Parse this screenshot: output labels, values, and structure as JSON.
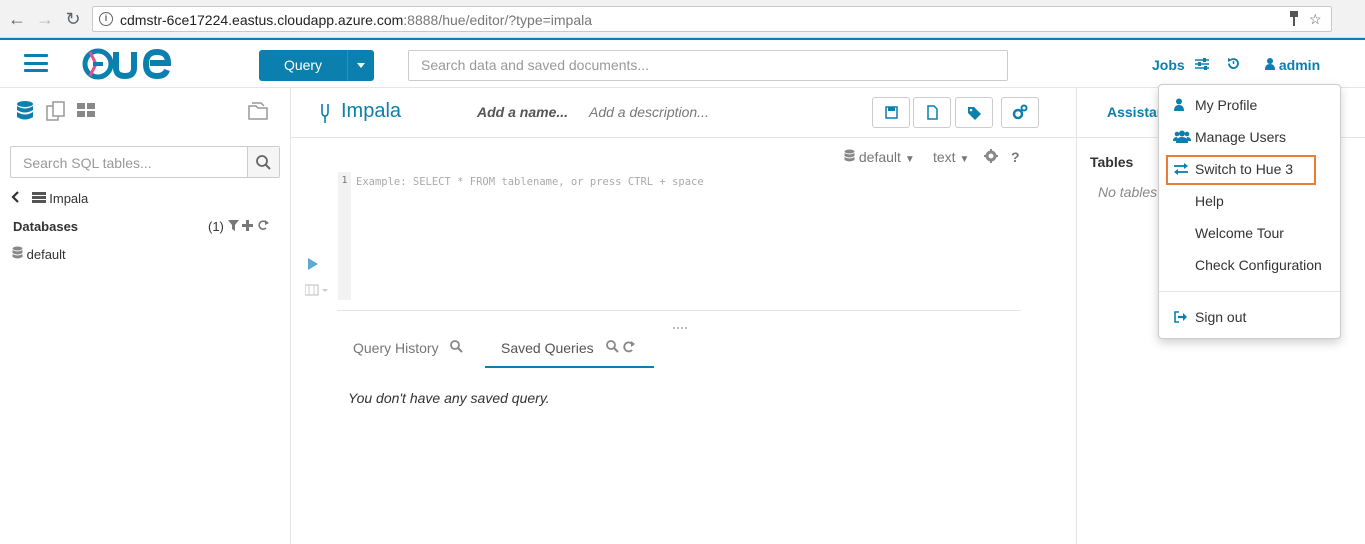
{
  "browser": {
    "url_host": "cdmstr-6ce17224.eastus.cloudapp.azure.com",
    "url_rest": ":8888/hue/editor/?type=impala"
  },
  "nav": {
    "logo": "HUE",
    "query_button": "Query",
    "search_placeholder": "Search data and saved documents...",
    "jobs": "Jobs",
    "user": "admin"
  },
  "left_panel": {
    "search_placeholder": "Search SQL tables...",
    "source": "Impala",
    "databases_label": "Databases",
    "databases_count": "(1)",
    "database_items": [
      "default"
    ]
  },
  "editor": {
    "title": "Impala",
    "name_placeholder": "Add a name...",
    "description_placeholder": "Add a description...",
    "database": "default",
    "format": "text",
    "help": "?",
    "line_number": "1",
    "code_placeholder": "Example: SELECT * FROM tablename, or press CTRL + space",
    "tabs": [
      "Query History",
      "Saved Queries"
    ],
    "active_tab": "Saved Queries",
    "empty_message": "You don't have any saved query."
  },
  "right_panel": {
    "tab": "Assistant",
    "tables_label": "Tables",
    "no_tables": "No tables"
  },
  "user_menu": {
    "items": [
      {
        "label": "My Profile",
        "icon": "user-icon"
      },
      {
        "label": "Manage Users",
        "icon": "users-icon"
      },
      {
        "label": "Switch to Hue 3",
        "icon": "exchange-icon"
      },
      {
        "label": "Help",
        "icon": ""
      },
      {
        "label": "Welcome Tour",
        "icon": ""
      },
      {
        "label": "Check Configuration",
        "icon": ""
      },
      {
        "label": "Sign out",
        "icon": "sign-out-icon"
      }
    ],
    "highlighted": "Switch to Hue 3"
  },
  "colors": {
    "brand": "#0b7fad",
    "highlight": "#ed7d31"
  }
}
